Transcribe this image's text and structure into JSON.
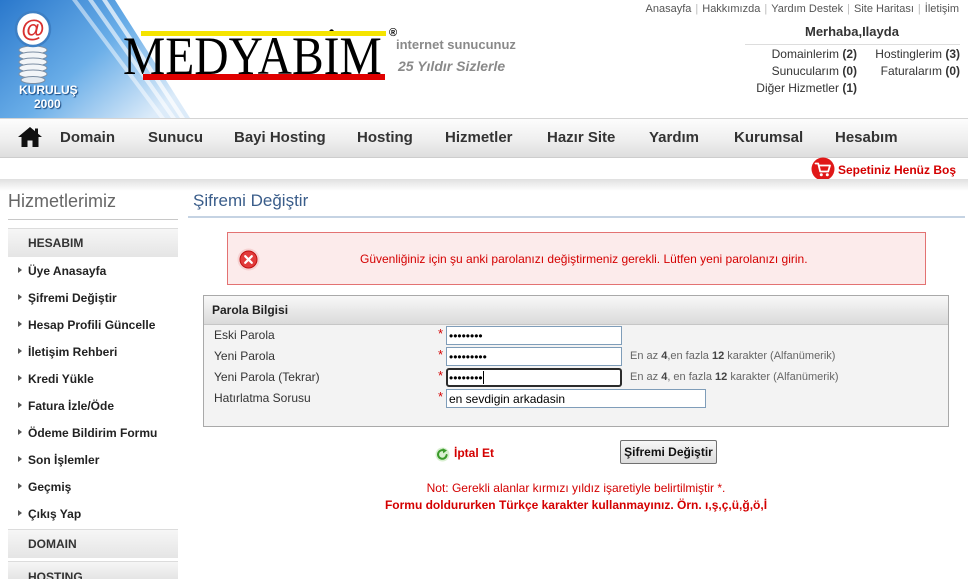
{
  "brand": {
    "founded_label": "KURULUŞ",
    "founded_year": "2000",
    "badge_glyph": "@",
    "name": "MEDYABİM",
    "registered_mark": "®",
    "tagline_top": "internet sunucunuz",
    "tagline_bottom": "25 Yıldır Sizlerle"
  },
  "top_links": [
    "Anasayfa",
    "Hakkımızda",
    "Yardım Destek",
    "Site Haritası",
    "İletişim"
  ],
  "account": {
    "greeting": "Merhaba,Ilayda",
    "summary": [
      {
        "label": "Domainlerim",
        "count": "(2)"
      },
      {
        "label": "Hostinglerim",
        "count": "(3)"
      },
      {
        "label": "Sunucularım",
        "count": "(0)"
      },
      {
        "label": "Faturalarım",
        "count": "(0)"
      },
      {
        "label": "Diğer Hizmetler",
        "count": "(1)"
      }
    ]
  },
  "nav": {
    "home_icon": "home-icon",
    "items": [
      "Domain",
      "Sunucu",
      "Bayi Hosting",
      "Hosting",
      "Hizmetler",
      "Hazır Site",
      "Yardım",
      "Kurumsal",
      "Hesabım"
    ]
  },
  "cart": {
    "icon": "cart-icon",
    "label": "Sepetiniz Henüz Boş"
  },
  "sidebar": {
    "title": "Hizmetlerimiz",
    "sections": [
      {
        "header": "HESABIM",
        "items": [
          "Üye Anasayfa",
          "Şifremi Değiştir",
          "Hesap Profili Güncelle",
          "İletişim Rehberi",
          "Kredi Yükle",
          "Fatura İzle/Öde",
          "Ödeme Bildirim Formu",
          "Son İşlemler",
          "Geçmiş",
          "Çıkış Yap"
        ]
      },
      {
        "header": "DOMAIN",
        "items": []
      },
      {
        "header": "HOSTING",
        "items": []
      }
    ]
  },
  "main": {
    "title": "Şifremi Değiştir",
    "alert": {
      "icon": "error-icon",
      "message": "Güvenliğiniz için şu anki parolanızı değiştirmeniz gerekli. Lütfen yeni parolanızı girin."
    },
    "form": {
      "legend": "Parola Bilgisi",
      "required_mark": "*",
      "fields": [
        {
          "label": "Eski Parola",
          "value": "••••••••"
        },
        {
          "label": "Yeni Parola",
          "value": "•••••••••",
          "hint": {
            "prefix": "En az ",
            "min": "4",
            "mid": ",en fazla ",
            "max": "12",
            "suffix": " karakter (Alfanümerik)"
          }
        },
        {
          "label": "Yeni Parola (Tekrar)",
          "value": "••••••••",
          "hint": {
            "prefix": "En az ",
            "min": "4",
            "mid": ", en fazla ",
            "max": "12",
            "suffix": " karakter (Alfanümerik)"
          }
        },
        {
          "label": "Hatırlatma Sorusu",
          "value": "en sevdigin arkadasin"
        }
      ]
    },
    "actions": {
      "cancel_icon": "refresh-icon",
      "cancel_label": "İptal Et",
      "submit_label": "Şifremi Değiştir"
    },
    "notes": [
      "Not: Gerekli alanlar kırmızı yıldız işaretiyle belirtilmiştir *.",
      "Formu doldururken Türkçe karakter kullanmayınız. Örn. ı,ş,ç,ü,ğ,ö,İ"
    ]
  },
  "colors": {
    "accent_red": "#d40000",
    "title_blue": "#3a5d8a",
    "alert_border": "#e37272",
    "alert_bg": "#fcebeb",
    "logo_blue": "#2a78cc"
  }
}
